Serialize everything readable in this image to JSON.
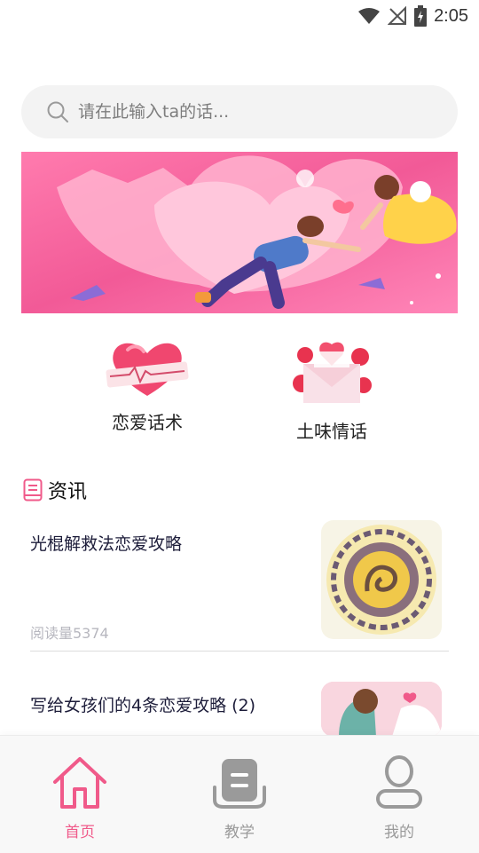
{
  "status": {
    "time": "2:05"
  },
  "search": {
    "placeholder": "请在此输入ta的话..."
  },
  "quick_links": [
    {
      "label": "恋爱话术",
      "icon": "heart-ecg-icon"
    },
    {
      "label": "土味情话",
      "icon": "love-letter-icon"
    }
  ],
  "news": {
    "section_title": "资讯",
    "items": [
      {
        "title": "光棍解救法恋爱攻略",
        "reads": "阅读量5374"
      },
      {
        "title": "写给女孩们的4条恋爱攻略 (2)"
      }
    ]
  },
  "tabs": [
    {
      "label": "首页",
      "icon": "home-icon",
      "active": true
    },
    {
      "label": "教学",
      "icon": "book-icon",
      "active": false
    },
    {
      "label": "我的",
      "icon": "user-icon",
      "active": false
    }
  ],
  "colors": {
    "accent": "#f05a8a",
    "inactive": "#9a9a9a"
  }
}
